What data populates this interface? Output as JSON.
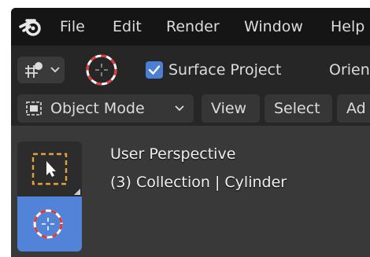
{
  "menubar": {
    "logo_icon": "blender-logo-icon",
    "items": [
      "File",
      "Edit",
      "Render",
      "Window",
      "Help"
    ]
  },
  "tool_header": {
    "transform_icon": "transform-pivot-icon",
    "cursor_icon": "3d-cursor-icon",
    "surface_project": {
      "label": "Surface Project",
      "checked": true
    },
    "orientation_label": "Orien"
  },
  "view_header": {
    "mode_icon": "object-mode-icon",
    "mode_label": "Object Mode",
    "menus": [
      "View",
      "Select",
      "Ad"
    ]
  },
  "viewport": {
    "overlay_line1": "User Perspective",
    "overlay_line2": "(3) Collection | Cylinder",
    "tools": [
      {
        "name": "select-box-tool",
        "icon": "select-box-icon",
        "active": false
      },
      {
        "name": "cursor-tool",
        "icon": "3d-cursor-icon",
        "active": true
      }
    ]
  },
  "colors": {
    "accent": "#4a7fd4",
    "active_tool": "#5183d8",
    "cursor_red": "#e23a3a",
    "select_box_orange": "#e2a13a"
  }
}
